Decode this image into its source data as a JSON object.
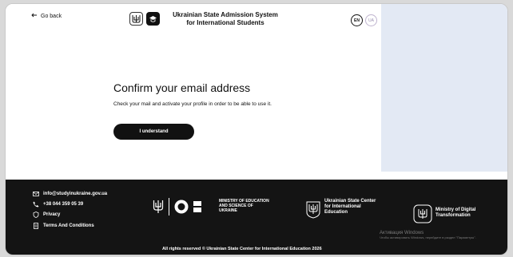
{
  "header": {
    "back_label": "Go back",
    "title_line1": "Ukrainian State Admission System",
    "title_line2": "for International Students",
    "lang_en": "EN",
    "lang_ua": "UA"
  },
  "main": {
    "title": "Confirm your email address",
    "message": "Check your mail and activate your profile in order to be able to use it.",
    "button_label": "I understand"
  },
  "footer": {
    "email": "info@studyinukraine.gov.ua",
    "phone": "+38 044 359 05 39",
    "privacy": "Privacy",
    "terms": "Terms And Conditions",
    "ministry": "MINISTRY OF EDUCATION AND SCIENCE OF UKRAINE",
    "center": "Ukrainian State Center for International Education",
    "digital": "Ministry of Digital Transformation",
    "copyright": "All rights reserved © Ukrainian State Center for International Education 2026"
  },
  "windows_activation": {
    "title": "Активация Windows",
    "subtitle": "Чтобы активировать Windows, перейдите в раздел \"Параметры\"."
  }
}
